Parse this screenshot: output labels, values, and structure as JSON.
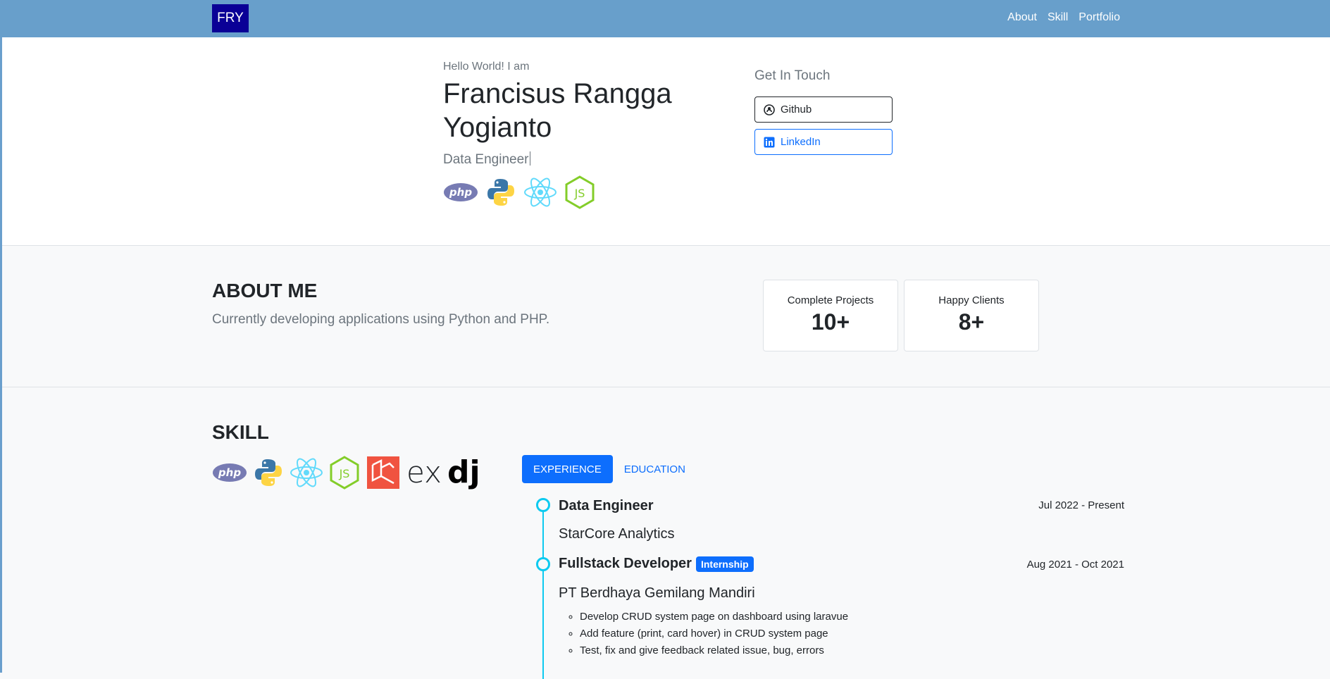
{
  "navbar": {
    "brand": "FRY",
    "links": [
      "About",
      "Skill",
      "Portfolio"
    ]
  },
  "hero": {
    "greeting": "Hello World! I am",
    "name": "Francisus Rangga Yogianto",
    "role": "Data Engineer",
    "icons": [
      "php-icon",
      "python-icon",
      "react-icon",
      "nodejs-icon"
    ],
    "get_in_touch": "Get In Touch",
    "github": "Github",
    "linkedin": "LinkedIn"
  },
  "about": {
    "title": "ABOUT ME",
    "text": "Currently developing applications using Python and PHP.",
    "stats": [
      {
        "label": "Complete Projects",
        "value": "10+"
      },
      {
        "label": "Happy Clients",
        "value": "8+"
      }
    ]
  },
  "skill": {
    "title": "SKILL",
    "icons": [
      "php-icon",
      "python-icon",
      "react-icon",
      "nodejs-icon",
      "laravel-icon",
      "express-icon",
      "django-icon"
    ],
    "express_text": "ex",
    "django_text": "dj",
    "tabs": [
      "EXPERIENCE",
      "EDUCATION"
    ],
    "jobs": [
      {
        "title": "Data Engineer",
        "company": "StarCore Analytics",
        "date": "Jul 2022 - Present"
      },
      {
        "title": "Fullstack Developer",
        "badge": "Internship",
        "company": "PT Berdhaya Gemilang Mandiri",
        "date": "Aug 2021 - Oct 2021",
        "duties": [
          "Develop CRUD system page on dashboard using laravue",
          "Add feature (print, card hover) in CRUD system page",
          "Test, fix and give feedback related issue, bug, errors"
        ]
      }
    ]
  },
  "colors": {
    "navbar": "#689fcb",
    "brand": "#0a0096",
    "primary": "#0d6efd",
    "timeline": "#0dcaf0"
  }
}
